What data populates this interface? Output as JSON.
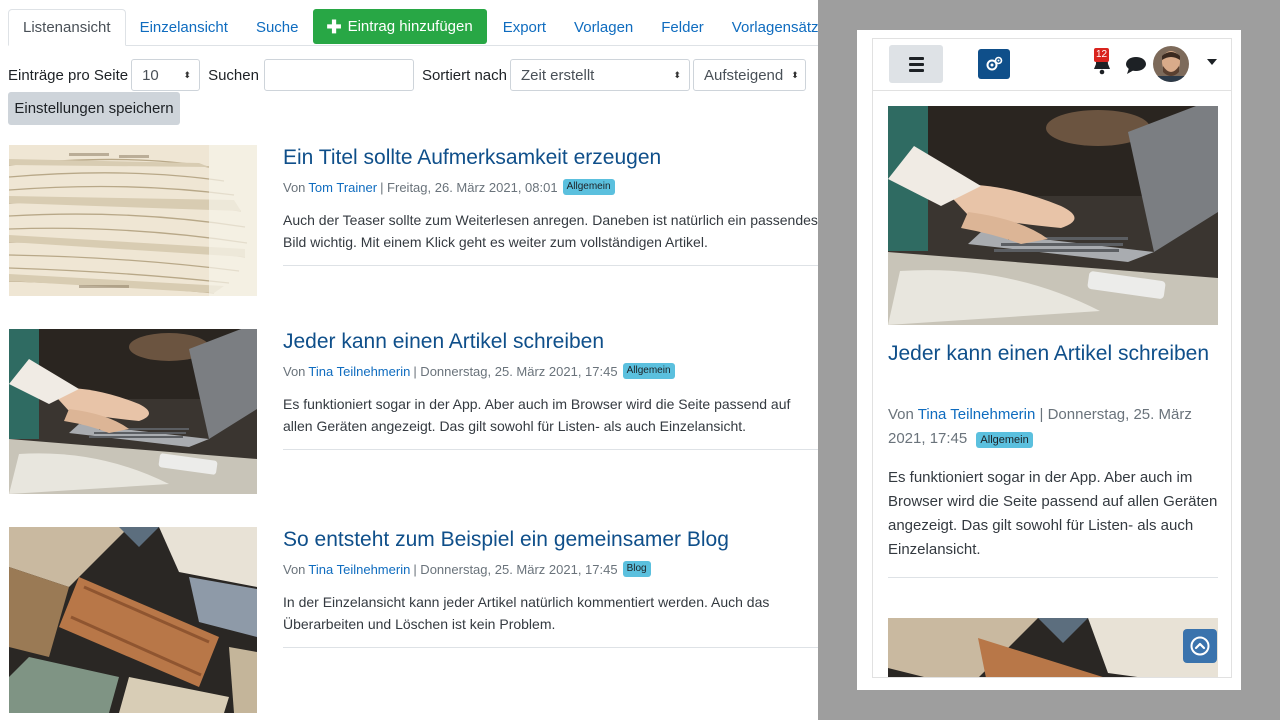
{
  "tabs": [
    {
      "label": "Listenansicht",
      "active": true
    },
    {
      "label": "Einzelansicht"
    },
    {
      "label": "Suche"
    },
    {
      "label": "Eintrag hinzufügen",
      "icon": "plus-icon"
    },
    {
      "label": "Export"
    },
    {
      "label": "Vorlagen"
    },
    {
      "label": "Felder"
    },
    {
      "label": "Vorlagensätze"
    }
  ],
  "controls": {
    "per_page_label": "Einträge pro Seite",
    "per_page_value": "10",
    "search_label": "Suchen",
    "search_value": "",
    "sort_label": "Sortiert nach",
    "sort_value": "Zeit erstellt",
    "order_value": "Aufsteigend",
    "save_label": "Einstellungen speichern"
  },
  "entries": [
    {
      "title": "Ein Titel sollte Aufmerksamkeit erzeugen",
      "by": "Von",
      "author": "Tom Trainer",
      "date": "| Freitag, 26. März 2021, 08:01",
      "tag": "Allgemein",
      "teaser": "Auch der Teaser sollte zum Weiterlesen anregen. Daneben ist natürlich ein passendes Bild wichtig. Mit einem Klick geht es weiter zum vollständigen Artikel.",
      "image": "newspaper-stack"
    },
    {
      "title": "Jeder kann einen Artikel schreiben",
      "by": "Von",
      "author": "Tina Teilnehmerin",
      "date": "| Donnerstag, 25. März 2021, 17:45",
      "tag": "Allgemein",
      "teaser": "Es funktioniert sogar in der App. Aber auch im Browser wird die Seite passend auf allen Geräten angezeigt. Das gilt sowohl für Listen- als auch Einzelansicht.",
      "image": "laptop-typing"
    },
    {
      "title": "So entsteht zum Beispiel ein gemeinsamer Blog",
      "by": "Von",
      "author": "Tina Teilnehmerin",
      "date": "| Donnerstag, 25. März 2021, 17:45",
      "tag": "Blog",
      "teaser": "In der Einzelansicht kann jeder Artikel natürlich kommentiert werden. Auch das Überarbeiten und Löschen ist kein Problem.",
      "image": "books-stack"
    }
  ],
  "mobile": {
    "notification_count": "12",
    "icons": [
      "hamburger-icon",
      "logo-gears-icon",
      "bell-icon",
      "chat-icon",
      "avatar",
      "chevron-down-icon",
      "arrow-up-icon"
    ],
    "entry": {
      "title": "Jeder kann einen Artikel schreiben",
      "by": "Von",
      "author": "Tina Teilnehmerin",
      "date": "| Donnerstag, 25. März 2021, 17:45",
      "tag": "Allgemein",
      "teaser": "Es funktioniert sogar in der App. Aber auch im Browser wird die Seite passend auf allen Geräten angezeigt. Das gilt sowohl für Listen- als auch Einzelansicht."
    }
  },
  "colors": {
    "link": "#0f6cbf",
    "title": "#0f4f8a",
    "add_button": "#28a745",
    "badge": "#5bc0de",
    "notification": "#d9241e"
  }
}
